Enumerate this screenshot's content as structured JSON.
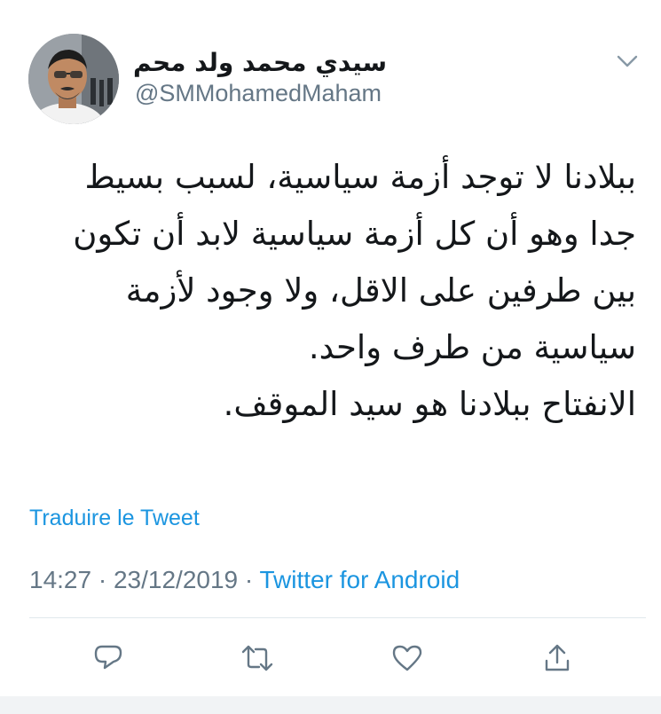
{
  "author": {
    "display_name": "سيدي محمد ولد محم",
    "handle": "@SMMohamedMaham",
    "avatar": "profile-photo"
  },
  "tweet": {
    "lines": [
      "ببلادنا لا توجد أزمة سياسية، لسبب بسيط",
      "جدا وهو أن كل أزمة سياسية لابد أن تكون",
      "بين طرفين على الاقل، ولا وجود لأزمة",
      "سياسية من طرف واحد.",
      "الانفتاح ببلادنا هو سيد الموقف."
    ],
    "translate_label": "Traduire le Tweet",
    "time": "14:27",
    "separator": "·",
    "date": "23/12/2019",
    "source": "Twitter for Android"
  },
  "actions": [
    {
      "icon": "reply-icon"
    },
    {
      "icon": "retweet-icon"
    },
    {
      "icon": "like-icon"
    },
    {
      "icon": "share-icon"
    }
  ],
  "colors": {
    "link": "#1b95e0",
    "secondary_text": "#657786",
    "primary_text": "#14171a",
    "icon": "#657786",
    "divider": "#e1e8ed"
  }
}
